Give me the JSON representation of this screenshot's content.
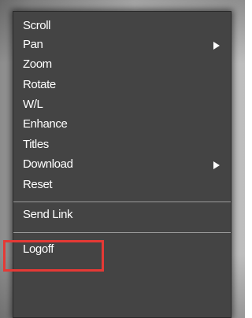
{
  "menu": {
    "items": [
      {
        "label": "Scroll"
      },
      {
        "label": "Pan",
        "submenu": true
      },
      {
        "label": "Zoom"
      },
      {
        "label": "Rotate"
      },
      {
        "label": "W/L"
      },
      {
        "label": "Enhance"
      },
      {
        "label": "Titles"
      },
      {
        "label": "Download",
        "submenu": true
      },
      {
        "label": "Reset"
      },
      {
        "label": "Send Link",
        "highlighted": true
      },
      {
        "label": "Logoff"
      }
    ]
  },
  "colors": {
    "menu_background": "#444444",
    "menu_text": "#ffffff",
    "separator": "#9a9a9a",
    "highlight_border": "#e53935"
  },
  "icons": {
    "submenu": "triangle-right-icon"
  }
}
